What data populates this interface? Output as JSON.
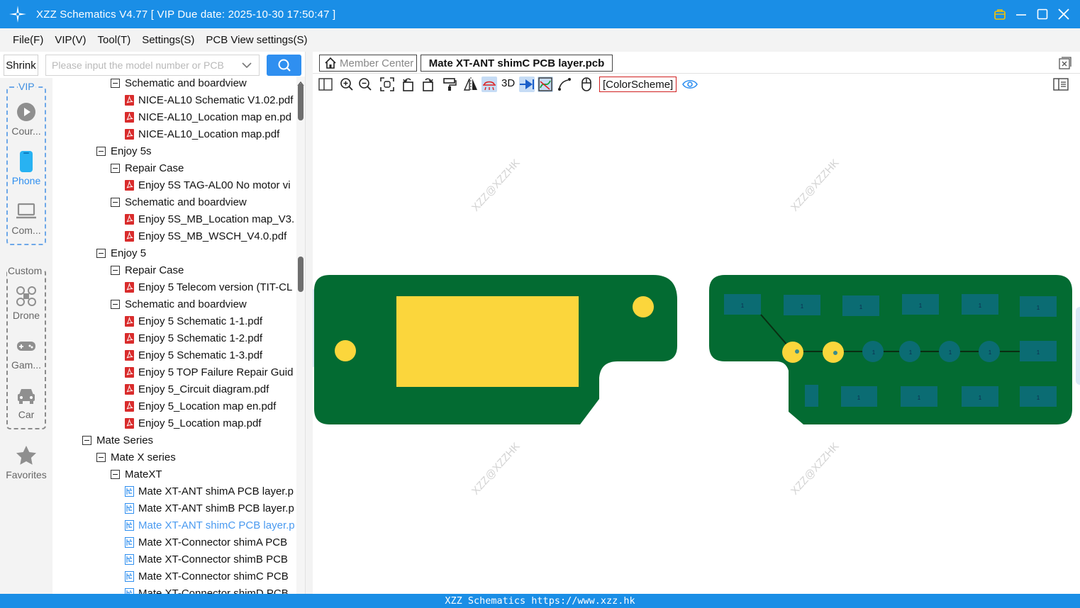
{
  "window": {
    "title": "XZZ Schematics V4.77 [ VIP Due date: 2025-10-30 17:50:47 ]"
  },
  "menu": [
    {
      "label": "File(F)"
    },
    {
      "label": "VIP(V)"
    },
    {
      "label": "Tool(T)"
    },
    {
      "label": "Settings(S)"
    },
    {
      "label": "PCB View settings(S)"
    }
  ],
  "search": {
    "shrink_label": "Shrink",
    "placeholder": "Please input the model number or PCB"
  },
  "categories": {
    "vip_label": "VIP",
    "custom_label": "Custom",
    "items": [
      {
        "label": "Cour...",
        "icon": "play-circle-icon"
      },
      {
        "label": "Phone",
        "icon": "phone-icon",
        "active": true
      },
      {
        "label": "Com...",
        "icon": "laptop-icon"
      },
      {
        "label": "Drone",
        "icon": "drone-icon"
      },
      {
        "label": "Gam...",
        "icon": "gamepad-icon"
      },
      {
        "label": "Car",
        "icon": "car-icon"
      },
      {
        "label": "Favorites",
        "icon": "star-icon"
      }
    ]
  },
  "tree": [
    {
      "label": "Schematic and boardview",
      "type": "folder",
      "level": 2
    },
    {
      "label": "NICE-AL10 Schematic V1.02.pdf",
      "type": "pdf",
      "level": 3
    },
    {
      "label": "NICE-AL10_Location map en.pd",
      "type": "pdf",
      "level": 3
    },
    {
      "label": "NICE-AL10_Location map.pdf",
      "type": "pdf",
      "level": 3
    },
    {
      "label": "Enjoy 5s",
      "type": "folder",
      "level": 1
    },
    {
      "label": "Repair Case",
      "type": "folder",
      "level": 2
    },
    {
      "label": "Enjoy 5S TAG-AL00 No motor vi",
      "type": "pdf",
      "level": 3
    },
    {
      "label": "Schematic and boardview",
      "type": "folder",
      "level": 2
    },
    {
      "label": "Enjoy 5S_MB_Location map_V3.",
      "type": "pdf",
      "level": 3
    },
    {
      "label": "Enjoy 5S_MB_WSCH_V4.0.pdf",
      "type": "pdf",
      "level": 3
    },
    {
      "label": "Enjoy 5",
      "type": "folder",
      "level": 1
    },
    {
      "label": "Repair Case",
      "type": "folder",
      "level": 2
    },
    {
      "label": "Enjoy 5 Telecom version (TIT-CL",
      "type": "pdf",
      "level": 3
    },
    {
      "label": "Schematic and boardview",
      "type": "folder",
      "level": 2
    },
    {
      "label": "Enjoy 5 Schematic 1-1.pdf",
      "type": "pdf",
      "level": 3
    },
    {
      "label": "Enjoy 5 Schematic 1-2.pdf",
      "type": "pdf",
      "level": 3
    },
    {
      "label": "Enjoy 5 Schematic 1-3.pdf",
      "type": "pdf",
      "level": 3
    },
    {
      "label": "Enjoy 5 TOP Failure Repair Guid",
      "type": "pdf",
      "level": 3
    },
    {
      "label": "Enjoy 5_Circuit diagram.pdf",
      "type": "pdf",
      "level": 3
    },
    {
      "label": "Enjoy 5_Location map en.pdf",
      "type": "pdf",
      "level": 3
    },
    {
      "label": "Enjoy 5_Location map.pdf",
      "type": "pdf",
      "level": 3
    },
    {
      "label": "Mate Series",
      "type": "folder",
      "level": 0
    },
    {
      "label": "Mate X series",
      "type": "folder",
      "level": 1
    },
    {
      "label": "MateXT",
      "type": "folder",
      "level": 2
    },
    {
      "label": "Mate XT-ANT shimA PCB layer.p",
      "type": "pcb",
      "level": 3
    },
    {
      "label": "Mate XT-ANT shimB PCB layer.p",
      "type": "pcb",
      "level": 3
    },
    {
      "label": "Mate XT-ANT shimC PCB layer.p",
      "type": "pcb",
      "level": 3,
      "active": true
    },
    {
      "label": "Mate XT-Connector shimA PCB",
      "type": "pcb",
      "level": 3
    },
    {
      "label": "Mate XT-Connector shimB PCB",
      "type": "pcb",
      "level": 3
    },
    {
      "label": "Mate XT-Connector shimC PCB",
      "type": "pcb",
      "level": 3
    },
    {
      "label": "Mate XT-Connector shimD PCB",
      "type": "pcb",
      "level": 3
    }
  ],
  "tabs": {
    "home_label": "Member Center",
    "active_label": "Mate XT-ANT shimC PCB layer.pcb"
  },
  "toolbar": {
    "three_d_label": "3D",
    "color_scheme_label": "[ColorScheme]",
    "icons": [
      "layout-icon",
      "zoom-in-icon",
      "zoom-out-icon",
      "fit-view-icon",
      "rotate-left-icon",
      "rotate-right-icon",
      "format-painter-icon",
      "mirror-icon",
      "probe-icon",
      "arrow-icon",
      "net-highlight-icon",
      "trace-icon",
      "mouse-icon",
      "eye-icon"
    ]
  },
  "canvas": {
    "watermark": "XZZ@XZZHK",
    "pad_label": "1",
    "board_color": "#036b32",
    "pad_color": "#fbd63c",
    "smd_color": "#0b6c73"
  },
  "status": {
    "text": "XZZ Schematics https://www.xzz.hk"
  }
}
